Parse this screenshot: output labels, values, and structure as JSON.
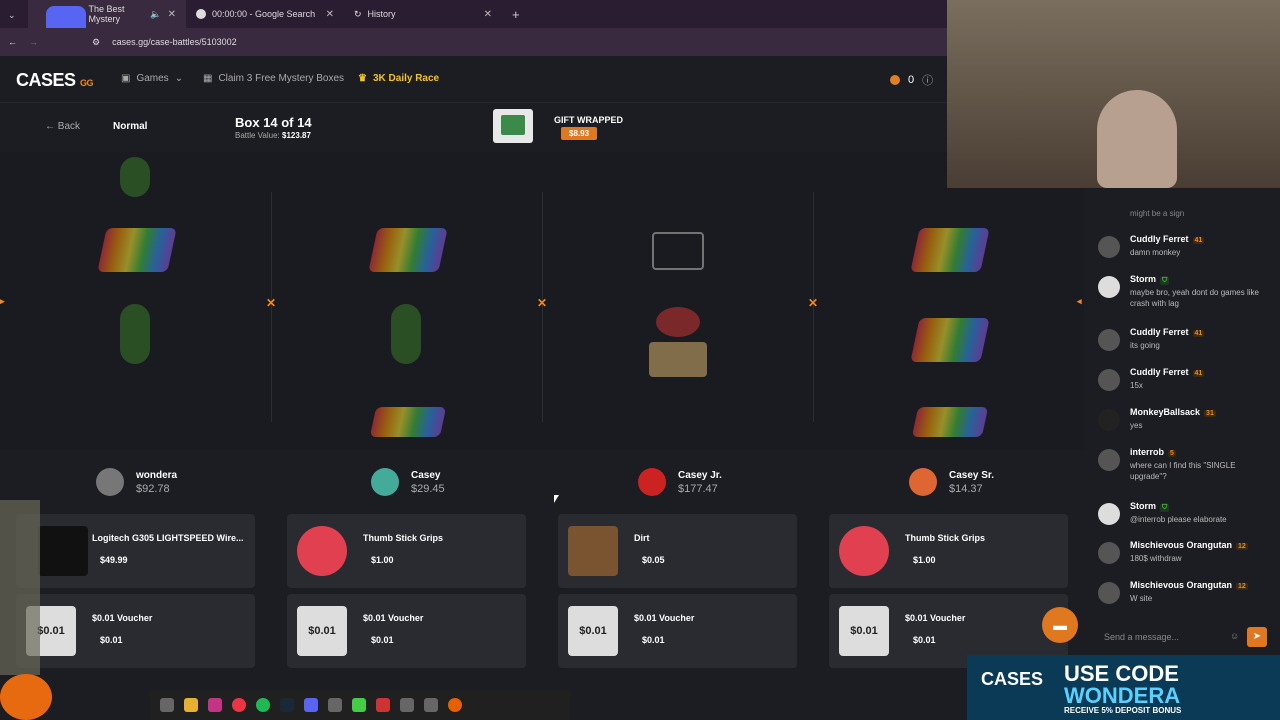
{
  "browser": {
    "tabs": [
      {
        "label": "The Best Mystery",
        "active": true
      },
      {
        "label": "00:00:00 - Google Search",
        "active": false
      },
      {
        "label": "History",
        "active": false
      }
    ],
    "url": "cases.gg/case-battles/5103002"
  },
  "site": {
    "logo": "CASES",
    "logo_sub": "GG",
    "nav_games": "Games",
    "nav_mystery": "Claim 3 Free Mystery Boxes",
    "nav_race": "3K Daily Race",
    "balance": "0"
  },
  "battle": {
    "back": "Back",
    "mode": "Normal",
    "box_num": "Box 14 of 14",
    "battle_value_label": "Battle Value:",
    "battle_value": "$123.87",
    "case_name": "GIFT WRAPPED",
    "case_price": "$8.93"
  },
  "players": [
    {
      "name": "wondera",
      "balance": "$92.78"
    },
    {
      "name": "Casey",
      "balance": "$29.45"
    },
    {
      "name": "Casey Jr.",
      "balance": "$177.47"
    },
    {
      "name": "Casey Sr.",
      "balance": "$14.37"
    }
  ],
  "drops_row1": [
    {
      "name": "Logitech G305 LIGHTSPEED Wire...",
      "price": "$49.99"
    },
    {
      "name": "Thumb Stick Grips",
      "price": "$1.00"
    },
    {
      "name": "Dirt",
      "price": "$0.05"
    },
    {
      "name": "Thumb Stick Grips",
      "price": "$1.00"
    }
  ],
  "drops_row2": [
    {
      "name": "$0.01 Voucher",
      "price": "$0.01",
      "voucher_text": "$0.01"
    },
    {
      "name": "$0.01 Voucher",
      "price": "$0.01",
      "voucher_text": "$0.01"
    },
    {
      "name": "$0.01 Voucher",
      "price": "$0.01",
      "voucher_text": "$0.01"
    },
    {
      "name": "$0.01 Voucher",
      "price": "$0.01",
      "voucher_text": "$0.01"
    }
  ],
  "chat": {
    "messages": [
      {
        "user": "Cuddly Ferret",
        "level": "41",
        "text": "damn monkey"
      },
      {
        "user": "Storm",
        "level": "",
        "text": "maybe bro, yeah dont do games like crash with lag"
      },
      {
        "user": "Cuddly Ferret",
        "level": "41",
        "text": "its going"
      },
      {
        "user": "Cuddly Ferret",
        "level": "41",
        "text": "15x"
      },
      {
        "user": "MonkeyBallsack",
        "level": "31",
        "text": "yes"
      },
      {
        "user": "interrob",
        "level": "5",
        "text": "where can I find this \"SINGLE upgrade\"?"
      },
      {
        "user": "Storm",
        "level": "",
        "text": "@interrob please elaborate"
      },
      {
        "user": "Mischievous Orangutan",
        "level": "12",
        "text": "180$ withdraw"
      },
      {
        "user": "Mischievous Orangutan",
        "level": "12",
        "text": "W site"
      }
    ],
    "prev_text": "might be a sign",
    "placeholder": "Send a message..."
  },
  "promo": {
    "logo": "CASES",
    "line1": "USE CODE",
    "line2": "WONDERA",
    "line3": "RECEIVE 5% DEPOSIT BONUS"
  },
  "colors": {
    "accent": "#e07820",
    "bg": "#1c1d22",
    "card": "#2a2b31"
  }
}
